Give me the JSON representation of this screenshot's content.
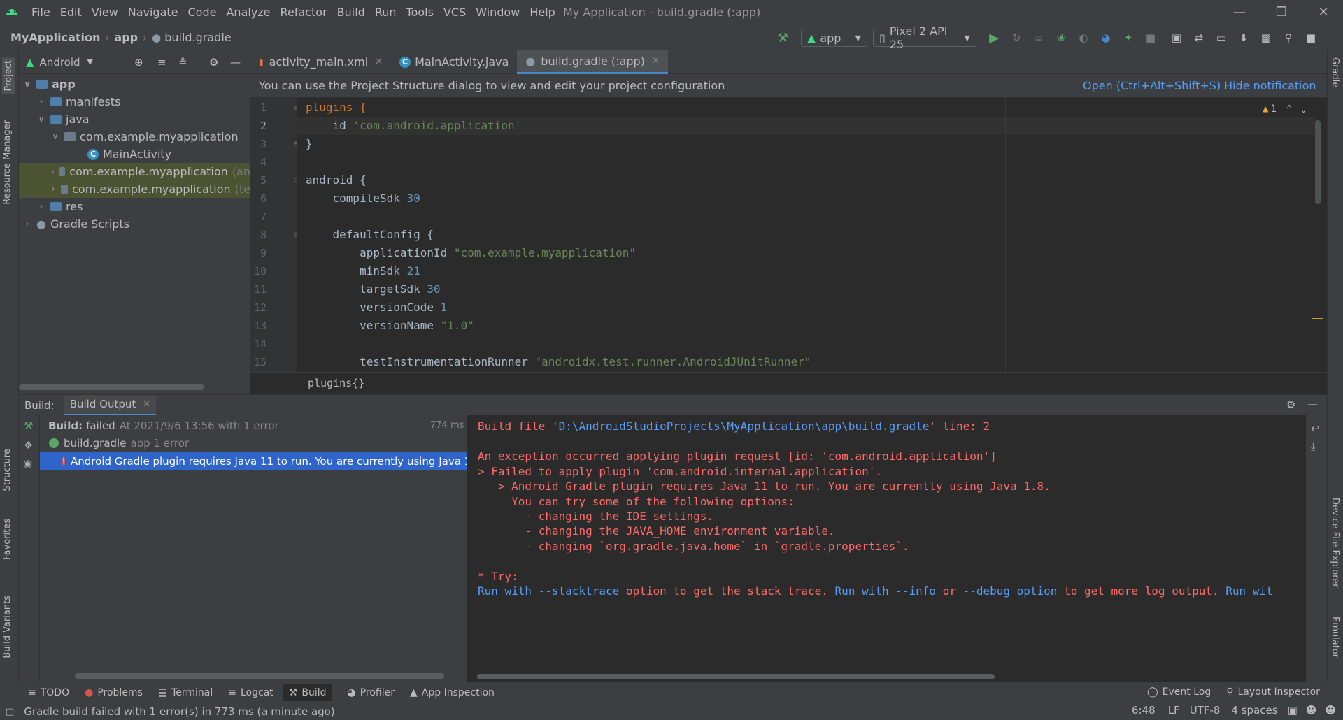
{
  "menubar": {
    "items": [
      "File",
      "Edit",
      "View",
      "Navigate",
      "Code",
      "Analyze",
      "Refactor",
      "Build",
      "Run",
      "Tools",
      "VCS",
      "Window",
      "Help"
    ],
    "window_title": "My Application - build.gradle (:app)"
  },
  "navbar": {
    "breadcrumbs": [
      "MyApplication",
      "app",
      "build.gradle"
    ],
    "run_config": "app",
    "device": "Pixel 2 API 25"
  },
  "left_stripe": {
    "project": "Project",
    "resource_manager": "Resource Manager",
    "structure": "Structure",
    "favorites": "Favorites",
    "build_variants": "Build Variants"
  },
  "right_stripe": {
    "gradle": "Gradle",
    "device_file_explorer": "Device File Explorer",
    "emulator": "Emulator"
  },
  "project_panel": {
    "view_mode": "Android",
    "tree": [
      {
        "label": "app",
        "suffix": ""
      },
      {
        "label": "manifests",
        "suffix": ""
      },
      {
        "label": "java",
        "suffix": ""
      },
      {
        "label": "com.example.myapplication",
        "suffix": ""
      },
      {
        "label": "MainActivity",
        "suffix": ""
      },
      {
        "label": "com.example.myapplication",
        "suffix": "(an"
      },
      {
        "label": "com.example.myapplication",
        "suffix": "(te"
      },
      {
        "label": "res",
        "suffix": ""
      },
      {
        "label": "Gradle Scripts",
        "suffix": ""
      }
    ]
  },
  "editor_tabs": [
    {
      "label": "activity_main.xml"
    },
    {
      "label": "MainActivity.java"
    },
    {
      "label": "build.gradle (:app)"
    }
  ],
  "notification": {
    "text": "You can use the Project Structure dialog to view and edit your project configuration",
    "open_link": "Open (Ctrl+Alt+Shift+S)",
    "hide_link": "Hide notification"
  },
  "editor": {
    "warning_count": "1",
    "line_numbers": [
      "1",
      "2",
      "3",
      "4",
      "5",
      "6",
      "7",
      "8",
      "9",
      "10",
      "11",
      "12",
      "13",
      "14",
      "15"
    ],
    "lines": {
      "l1_kw": "plugins {",
      "l2_a": "    id ",
      "l2_s": "'com.android.application'",
      "l3": "}",
      "l5": "android {",
      "l6_a": "    compileSdk ",
      "l6_n": "30",
      "l8": "    defaultConfig {",
      "l9_a": "        applicationId ",
      "l9_s": "\"com.example.myapplication\"",
      "l10_a": "        minSdk ",
      "l10_n": "21",
      "l11_a": "        targetSdk ",
      "l11_n": "30",
      "l12_a": "        versionCode ",
      "l12_n": "1",
      "l13_a": "        versionName ",
      "l13_s": "\"1.0\"",
      "l15_a": "        testInstrumentationRunner ",
      "l15_s": "\"androidx.test.runner.AndroidJUnitRunner\""
    },
    "breadcrumb": "plugins{}"
  },
  "build_panel": {
    "label": "Build:",
    "tab": "Build Output",
    "status_bold": "Build:",
    "status_failed": "failed",
    "status_detail": "At 2021/9/6 13:56 with 1 error",
    "duration": "774 ms",
    "file_label": "build.gradle",
    "file_detail": "app 1 error",
    "error_message": "Android Gradle plugin requires Java 11 to run. You are currently using Java 1",
    "console": {
      "line1_pre": "Build file '",
      "line1_link": "D:\\AndroidStudioProjects\\MyApplication\\app\\build.gradle",
      "line1_post": "' line: 2",
      "line3": "An exception occurred applying plugin request [id: 'com.android.application']",
      "line4": "> Failed to apply plugin 'com.android.internal.application'.",
      "line5": "   > Android Gradle plugin requires Java 11 to run. You are currently using Java 1.8.",
      "line6": "     You can try some of the following options:",
      "line7": "       - changing the IDE settings.",
      "line8": "       - changing the JAVA_HOME environment variable.",
      "line9": "       - changing `org.gradle.java.home` in `gradle.properties`.",
      "line11": "* Try:",
      "line12_link1": "Run with --stacktrace",
      "line12_t1": " option to get the stack trace. ",
      "line12_link2": "Run with --info",
      "line12_t2": " or ",
      "line12_link3": "--debug option",
      "line12_t3": " to get more log output. ",
      "line12_link4": "Run wit"
    }
  },
  "bottom_tools": {
    "todo": "TODO",
    "problems": "Problems",
    "terminal": "Terminal",
    "logcat": "Logcat",
    "build": "Build",
    "profiler": "Profiler",
    "app_inspection": "App Inspection",
    "event_log": "Event Log",
    "layout_inspector": "Layout Inspector"
  },
  "statusbar": {
    "message": "Gradle build failed with 1 error(s) in 773 ms (a minute ago)",
    "position": "6:48",
    "line_sep": "LF",
    "encoding": "UTF-8",
    "indent": "4 spaces"
  },
  "colors": {
    "accent": "#4a88c7",
    "error": "#ff6b68",
    "link": "#589df6",
    "android_green": "#3ddc84"
  }
}
